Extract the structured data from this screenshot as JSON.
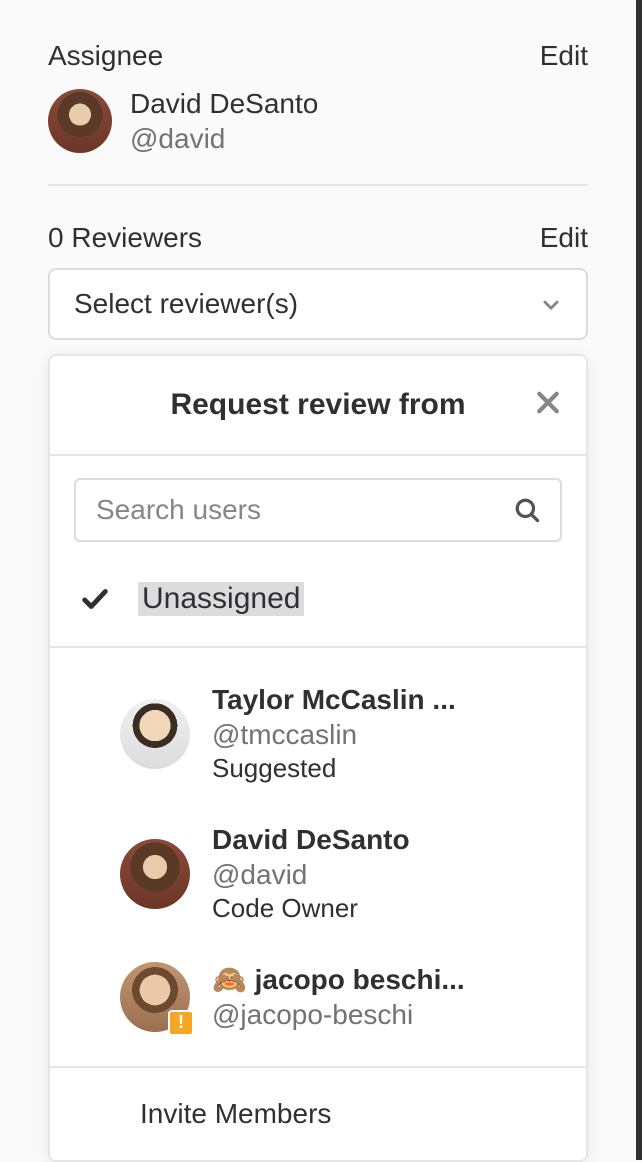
{
  "assignee": {
    "label": "Assignee",
    "edit": "Edit",
    "user": {
      "name": "David DeSanto",
      "handle": "@david"
    }
  },
  "reviewers": {
    "count_label": "0 Reviewers",
    "edit": "Edit",
    "select_placeholder": "Select reviewer(s)"
  },
  "dropdown": {
    "title": "Request review from",
    "search_placeholder": "Search users",
    "unassigned": "Unassigned",
    "invite": "Invite Members",
    "users": [
      {
        "name": "Taylor McCaslin ...",
        "handle": "@tmccaslin",
        "meta": "Suggested",
        "emoji": ""
      },
      {
        "name": "David DeSanto",
        "handle": "@david",
        "meta": "Code Owner",
        "emoji": ""
      },
      {
        "name": "jacopo beschi...",
        "handle": "@jacopo-beschi",
        "meta": "",
        "emoji": "🙈 "
      }
    ]
  }
}
